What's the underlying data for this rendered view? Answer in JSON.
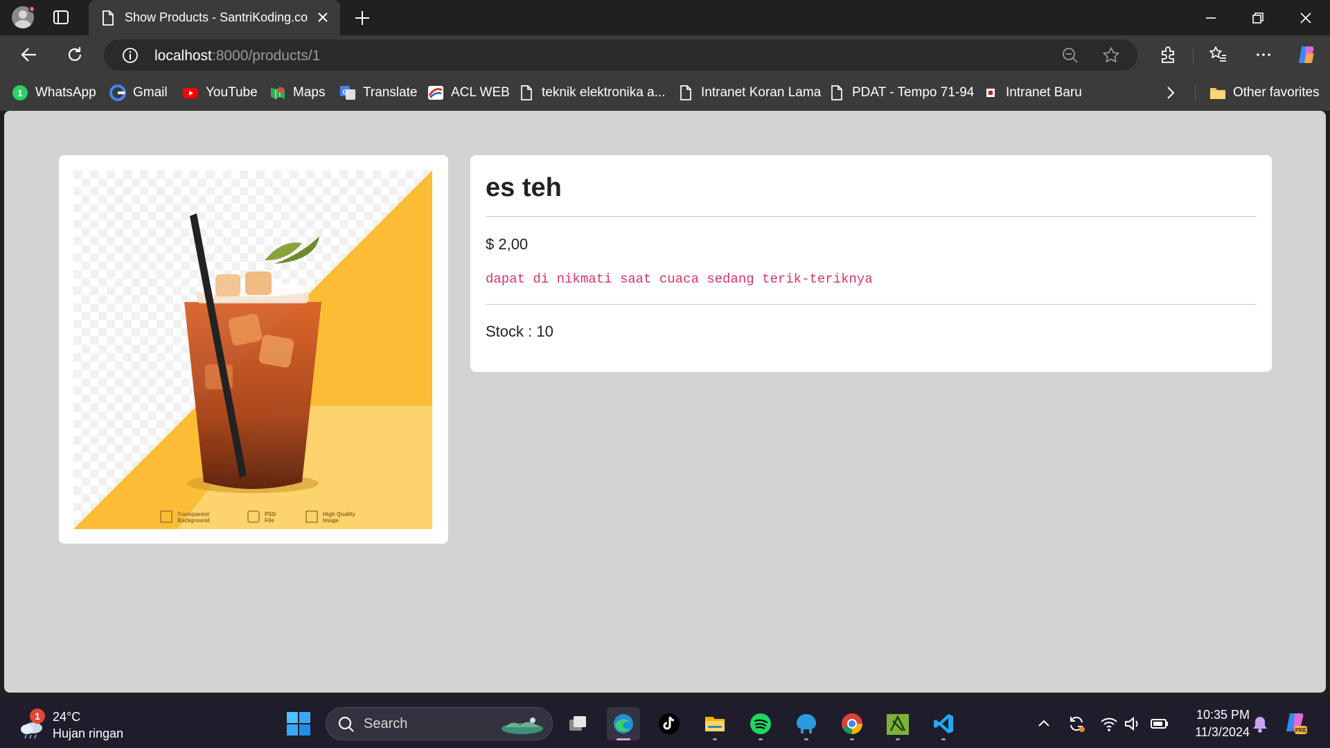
{
  "browser": {
    "tab": {
      "title": "Show Products - SantriKoding.com",
      "icon": "page-icon"
    },
    "new_tab_icon": "plus-icon",
    "window_controls": [
      "minimize-icon",
      "restore-icon",
      "close-icon"
    ],
    "address": {
      "host": "localhost",
      "path": ":8000/products/1"
    },
    "toolbar_icons": [
      "back-icon",
      "refresh-icon",
      "info-icon",
      "zoom-out-icon",
      "favorite-star-icon",
      "extensions-icon",
      "favorites-icon",
      "more-icon",
      "copilot-icon"
    ],
    "bookmarks": [
      {
        "label": "WhatsApp",
        "icon": "whatsapp-icon"
      },
      {
        "label": "Gmail",
        "icon": "google-icon"
      },
      {
        "label": "YouTube",
        "icon": "youtube-icon"
      },
      {
        "label": "Maps",
        "icon": "maps-icon"
      },
      {
        "label": "Translate",
        "icon": "translate-icon"
      },
      {
        "label": "ACL WEB",
        "icon": "acl-icon"
      },
      {
        "label": "teknik elektronika a...",
        "icon": "page-icon"
      },
      {
        "label": "Intranet Koran Lama",
        "icon": "page-icon"
      },
      {
        "label": "PDAT - Tempo 71-94",
        "icon": "page-icon"
      },
      {
        "label": "Intranet Baru",
        "icon": "site-icon"
      }
    ],
    "other_favorites": "Other favorites"
  },
  "product": {
    "name": "es teh",
    "price": "$ 2,00",
    "description": "dapat di nikmati saat cuaca sedang terik-teriknya",
    "stock": "Stock : 10",
    "image": {
      "alt": "iced tea",
      "badges": [
        {
          "line1": "Transparent",
          "line2": "Background"
        },
        {
          "line1": "PSD",
          "line2": "File"
        },
        {
          "line1": "High Quality",
          "line2": "Image"
        }
      ]
    }
  },
  "taskbar": {
    "weather": {
      "badge": "1",
      "temp": "24°C",
      "condition": "Hujan ringan"
    },
    "search_placeholder": "Search",
    "apps": [
      "task-view-icon",
      "edge-icon",
      "tiktok-icon",
      "file-explorer-icon",
      "spotify-icon",
      "app-icon",
      "chrome-icon",
      "xampp-icon",
      "vscode-icon"
    ],
    "tray": [
      "chevron-up-icon",
      "sync-icon",
      "wifi-icon",
      "volume-icon",
      "battery-icon",
      "notification-bell-icon",
      "copilot-icon"
    ],
    "time": "10:35 PM",
    "date": "11/3/2024"
  },
  "colors": {
    "chrome_dark": "#202020",
    "chrome": "#3b3b3b",
    "page_bg": "#d3d3d3",
    "description_text": "#d6336c",
    "taskbar": "#1f1d2c"
  }
}
